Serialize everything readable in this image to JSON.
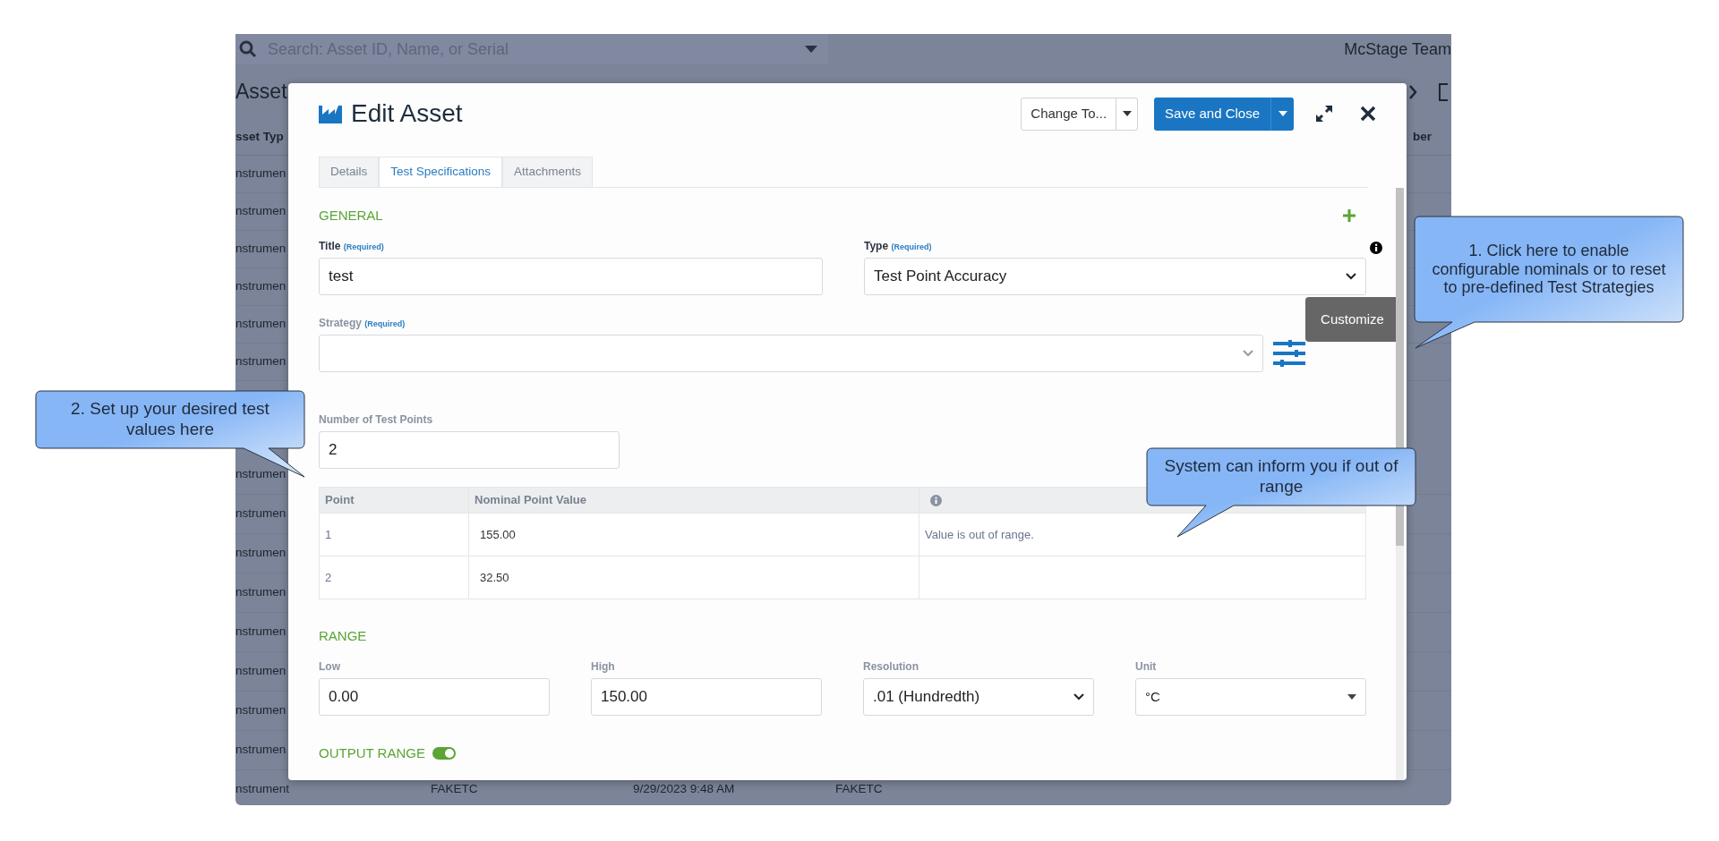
{
  "background": {
    "search_placeholder": "Search: Asset ID, Name, or Serial",
    "team": "McStage Team",
    "heading": "Asset",
    "columns": [
      "sset Typ",
      "ber"
    ],
    "rows": [
      {
        "cells": [
          "nstrumen"
        ]
      },
      {
        "cells": [
          "nstrumen"
        ]
      },
      {
        "cells": [
          "nstrumen"
        ]
      },
      {
        "cells": [
          "nstrumen"
        ]
      },
      {
        "cells": [
          "nstrumen"
        ]
      },
      {
        "cells": [
          "nstrumen"
        ]
      },
      {
        "cells": [
          "nstrumen"
        ]
      },
      {
        "cells": [
          "nstrumen"
        ]
      },
      {
        "cells": [
          "nstrumen"
        ]
      },
      {
        "cells": [
          "nstrumen"
        ]
      },
      {
        "cells": [
          "nstrumen"
        ]
      },
      {
        "cells": [
          "nstrumen"
        ]
      },
      {
        "cells": [
          "nstrumen"
        ]
      },
      {
        "cells": [
          "nstrumen"
        ]
      },
      {
        "cells": [
          "nstrument",
          "FAKETC",
          "9/29/2023 9:48 AM",
          "FAKETC"
        ]
      }
    ]
  },
  "modal": {
    "title": "Edit Asset",
    "change_to": "Change To...",
    "save": "Save and Close",
    "tabs": [
      {
        "label": "Details",
        "selected": false
      },
      {
        "label": "Test Specifications",
        "selected": true
      },
      {
        "label": "Attachments",
        "selected": false
      }
    ],
    "general": {
      "heading": "GENERAL",
      "title": {
        "label": "Title",
        "required": "(Required)",
        "value": "test"
      },
      "type": {
        "label": "Type",
        "required": "(Required)",
        "value": "Test Point Accuracy"
      },
      "strategy": {
        "label": "Strategy",
        "required": "(Required)"
      },
      "tooltip": "Customize"
    },
    "test_points": {
      "label": "Number of Test Points",
      "value": "2"
    },
    "table": {
      "columns": [
        "Point",
        "Nominal Point Value"
      ],
      "rows": [
        {
          "point": "1",
          "value": "155.00",
          "message": "Value is out of range."
        },
        {
          "point": "2",
          "value": "32.50"
        }
      ]
    },
    "range": {
      "heading": "RANGE",
      "fields": [
        {
          "label": "Low",
          "value": "0.00",
          "kind": "input"
        },
        {
          "label": "High",
          "value": "150.00",
          "kind": "input"
        },
        {
          "label": "Resolution",
          "value": ".01 (Hundredth)",
          "kind": "select"
        },
        {
          "label": "Unit",
          "value": "°C",
          "kind": "dropdown"
        }
      ]
    },
    "output_range": {
      "label": "OUTPUT RANGE",
      "on": true
    }
  },
  "callouts": [
    {
      "text": "1. Click here to enable configurable nominals or to reset to pre-defined Test Strategies"
    },
    {
      "text": "2. Set up your desired test values here"
    },
    {
      "text": "System can inform you if out of range"
    }
  ]
}
